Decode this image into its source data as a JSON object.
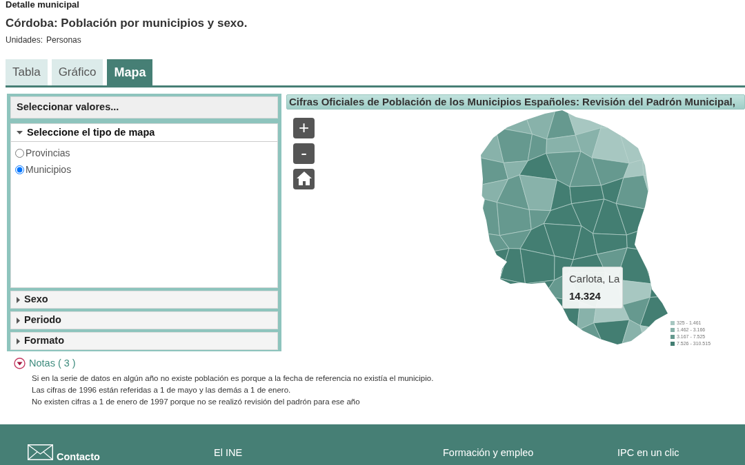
{
  "breadcrumb": "Detalle municipal",
  "title": "Córdoba: Población por municipios y sexo.",
  "units": {
    "label": "Unidades:",
    "value": "Personas"
  },
  "tabs": [
    {
      "label": "Tabla",
      "selected": false
    },
    {
      "label": "Gráfico",
      "selected": false
    },
    {
      "label": "Mapa",
      "selected": true
    }
  ],
  "selector": {
    "title": "Seleccionar valores...",
    "sections": [
      {
        "title": "Seleccione el tipo de mapa",
        "expanded": true,
        "options": [
          {
            "label": "Provincias",
            "selected": false
          },
          {
            "label": "Municipios",
            "selected": true
          }
        ]
      },
      {
        "title": "Sexo",
        "expanded": false
      },
      {
        "title": "Periodo",
        "expanded": false
      },
      {
        "title": "Formato",
        "expanded": false
      }
    ]
  },
  "map": {
    "title": "Cifras Oficiales de Población de los Municipios Españoles: Revisión del Padrón Municipal,",
    "controls": [
      {
        "kind": "zoom-in",
        "label": "+"
      },
      {
        "kind": "zoom-out",
        "label": "-"
      },
      {
        "kind": "home"
      }
    ],
    "tooltip": {
      "name": "Carlota, La",
      "value": "14.324"
    },
    "legend": [
      {
        "label": "325 - 1.461",
        "color": "#a7c7c1"
      },
      {
        "label": "1.462 - 3.166",
        "color": "#88b2aa"
      },
      {
        "label": "3.167 - 7.525",
        "color": "#66998f"
      },
      {
        "label": "7.526 - 310.515",
        "color": "#437e72"
      }
    ]
  },
  "notes": {
    "title": "Notas ( 3 )",
    "expanded": true,
    "items": [
      "Si en la serie de datos en algún año no existe población es porque a la fecha de referencia no existía el municipio.",
      "Las cifras de 1996 están referidas a 1 de mayo y las demás a 1 de enero.",
      "No existen cifras a 1 de enero de 1997 porque no se realizó revisión del padrón para ese año"
    ]
  },
  "footer": {
    "contact": "Contacto",
    "columns": [
      "El INE",
      "Formación y empleo",
      "IPC en un clic"
    ]
  }
}
